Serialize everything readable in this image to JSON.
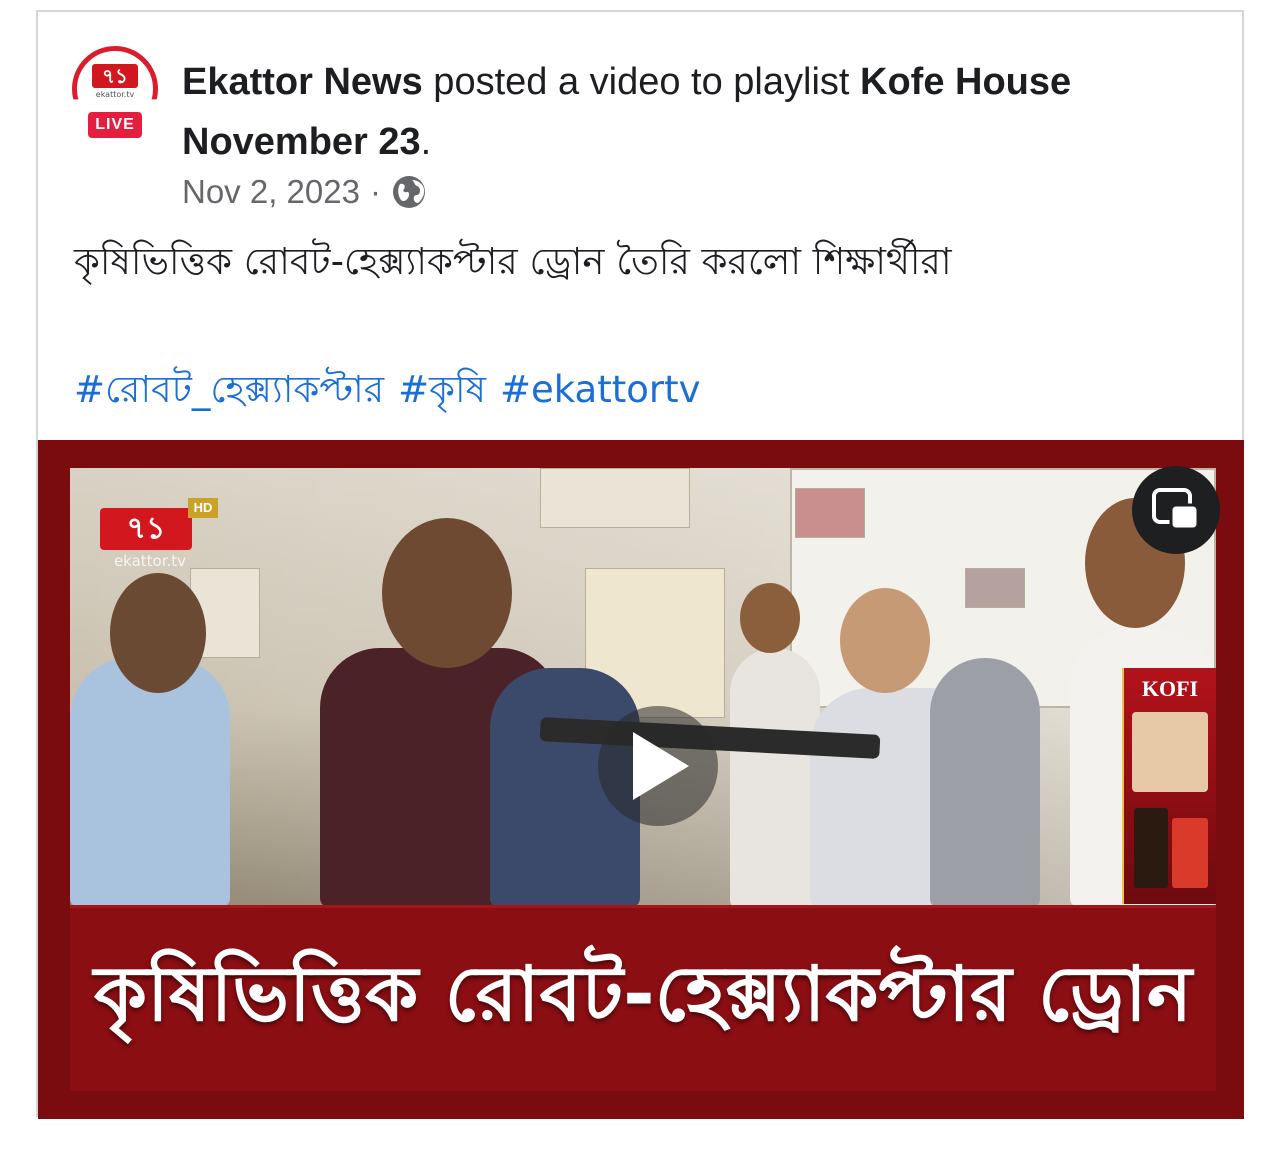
{
  "post": {
    "page_name": "Ekattor News",
    "action_text": " posted a video to playlist ",
    "playlist_name": "Kofe House November 23",
    "period": ".",
    "date": "Nov 2, 2023",
    "separator": "·",
    "privacy_icon": "globe-icon",
    "text": "কৃষিভিত্তিক রোবট-হেক্স্যাকপ্টার ড্রোন তৈরি করলো শিক্ষার্থীরা",
    "hashtags": [
      "#রোবট_হেক্স্যাকপ্টার",
      "#কৃষি",
      "#ekattortv"
    ]
  },
  "avatar": {
    "logo_text": "৭১",
    "logo_sub": "ekattor.tv",
    "live_label": "LIVE",
    "accent": "#dd1c2b"
  },
  "video": {
    "channel_logo": "৭১",
    "hd_label": "HD",
    "channel_sub": "ekattor.tv",
    "ad_brand": "KOFI",
    "banner_text": "কৃষিভিত্তিক রোবট-হেক্স্যাকপ্টার ড্রোন",
    "play_icon": "play-icon",
    "pip_icon": "picture-in-picture-icon",
    "banner_color": "#8b0e13"
  },
  "colors": {
    "hashtag": "#1a6ed8",
    "meta": "#65676b",
    "text": "#1c1e21"
  }
}
